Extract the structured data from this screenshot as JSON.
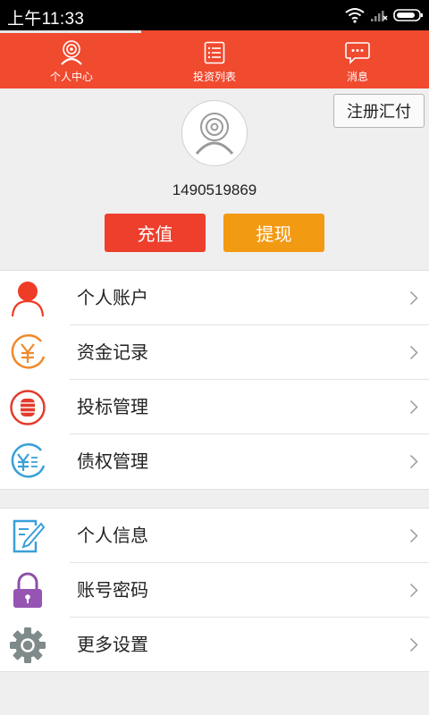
{
  "status_bar": {
    "time": "上午11:33"
  },
  "tabs": [
    {
      "label": "个人中心",
      "icon": "user-center-icon"
    },
    {
      "label": "投资列表",
      "icon": "list-icon"
    },
    {
      "label": "消息",
      "icon": "message-icon"
    }
  ],
  "profile": {
    "summary_button": "注册汇付",
    "phone": "1490519869",
    "recharge_label": "充值",
    "withdraw_label": "提现"
  },
  "menu_group_1": [
    {
      "label": "个人账户",
      "icon": "person-icon"
    },
    {
      "label": "资金记录",
      "icon": "yuan-circle-icon"
    },
    {
      "label": "投标管理",
      "icon": "coin-stack-icon"
    },
    {
      "label": "债权管理",
      "icon": "yuan-list-icon"
    }
  ],
  "menu_group_2": [
    {
      "label": "个人信息",
      "icon": "edit-icon"
    },
    {
      "label": "账号密码",
      "icon": "lock-icon"
    },
    {
      "label": "更多设置",
      "icon": "gear-icon"
    }
  ],
  "colors": {
    "brand_red": "#f04a2f",
    "button_red": "#ee3f2c",
    "button_orange": "#f39a13"
  }
}
